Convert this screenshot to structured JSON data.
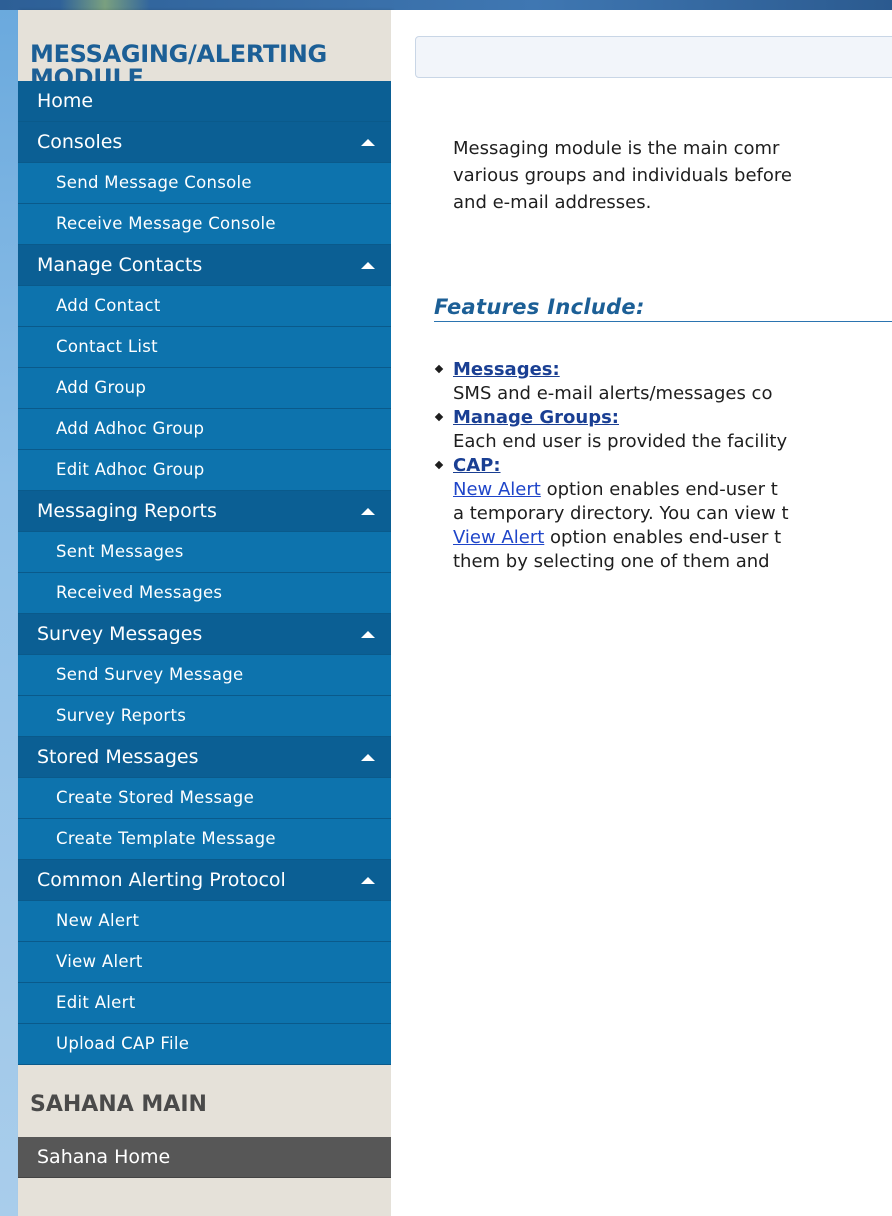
{
  "sidebar": {
    "module_title_line1": "MESSAGING/ALERTING",
    "module_title_line2": "MODULE",
    "menu": [
      {
        "label": "Home",
        "type": "main",
        "arrow": false
      },
      {
        "label": "Consoles",
        "type": "main",
        "arrow": true
      },
      {
        "label": "Send Message Console",
        "type": "sub"
      },
      {
        "label": "Receive Message Console",
        "type": "sub"
      },
      {
        "label": "Manage Contacts",
        "type": "main",
        "arrow": true
      },
      {
        "label": "Add Contact",
        "type": "sub"
      },
      {
        "label": "Contact List",
        "type": "sub"
      },
      {
        "label": "Add Group",
        "type": "sub"
      },
      {
        "label": "Add Adhoc Group",
        "type": "sub"
      },
      {
        "label": "Edit Adhoc Group",
        "type": "sub"
      },
      {
        "label": "Messaging Reports",
        "type": "main",
        "arrow": true
      },
      {
        "label": "Sent Messages",
        "type": "sub"
      },
      {
        "label": "Received Messages",
        "type": "sub"
      },
      {
        "label": "Survey Messages",
        "type": "main",
        "arrow": true
      },
      {
        "label": "Send Survey Message",
        "type": "sub"
      },
      {
        "label": "Survey Reports",
        "type": "sub"
      },
      {
        "label": "Stored Messages",
        "type": "main",
        "arrow": true
      },
      {
        "label": "Create Stored Message",
        "type": "sub"
      },
      {
        "label": "Create Template Message",
        "type": "sub"
      },
      {
        "label": "Common Alerting Protocol",
        "type": "main",
        "arrow": true
      },
      {
        "label": "New Alert",
        "type": "sub"
      },
      {
        "label": "View Alert",
        "type": "sub"
      },
      {
        "label": "Edit Alert",
        "type": "sub"
      },
      {
        "label": "Upload CAP File",
        "type": "sub"
      }
    ],
    "main_title": "SAHANA MAIN",
    "main_menu": [
      {
        "label": "Sahana Home"
      }
    ]
  },
  "content": {
    "intro_line1": "Messaging module is the main comr",
    "intro_line2": "various groups and individuals before",
    "intro_line3": "and e-mail addresses.",
    "features_heading": "Features Include:",
    "features": {
      "messages_title": "Messages:",
      "messages_desc": "SMS and e-mail alerts/messages co",
      "groups_title": "Manage Groups:",
      "groups_desc": "Each end user is provided the facility",
      "cap_title": "CAP:",
      "cap_link1": "New Alert",
      "cap_line1_rest": " option enables end-user t",
      "cap_line2": "a temporary directory. You can view t",
      "cap_link2": "View Alert",
      "cap_line3_rest": " option enables end-user t",
      "cap_line4": "them by selecting one of them and"
    }
  },
  "colors": {
    "module_title": "#1c5f96",
    "main_item_bg": "#0b5f94",
    "sub_item_bg": "#0d73ad",
    "sidebar_bg": "#e5e1d9",
    "dark_item_bg": "#575757",
    "feature_title": "#1a3f93",
    "link": "#1f45c9"
  },
  "icons": {
    "menu_arrow": "triangle-up-icon",
    "bullet": "diamond-bullet-icon"
  }
}
